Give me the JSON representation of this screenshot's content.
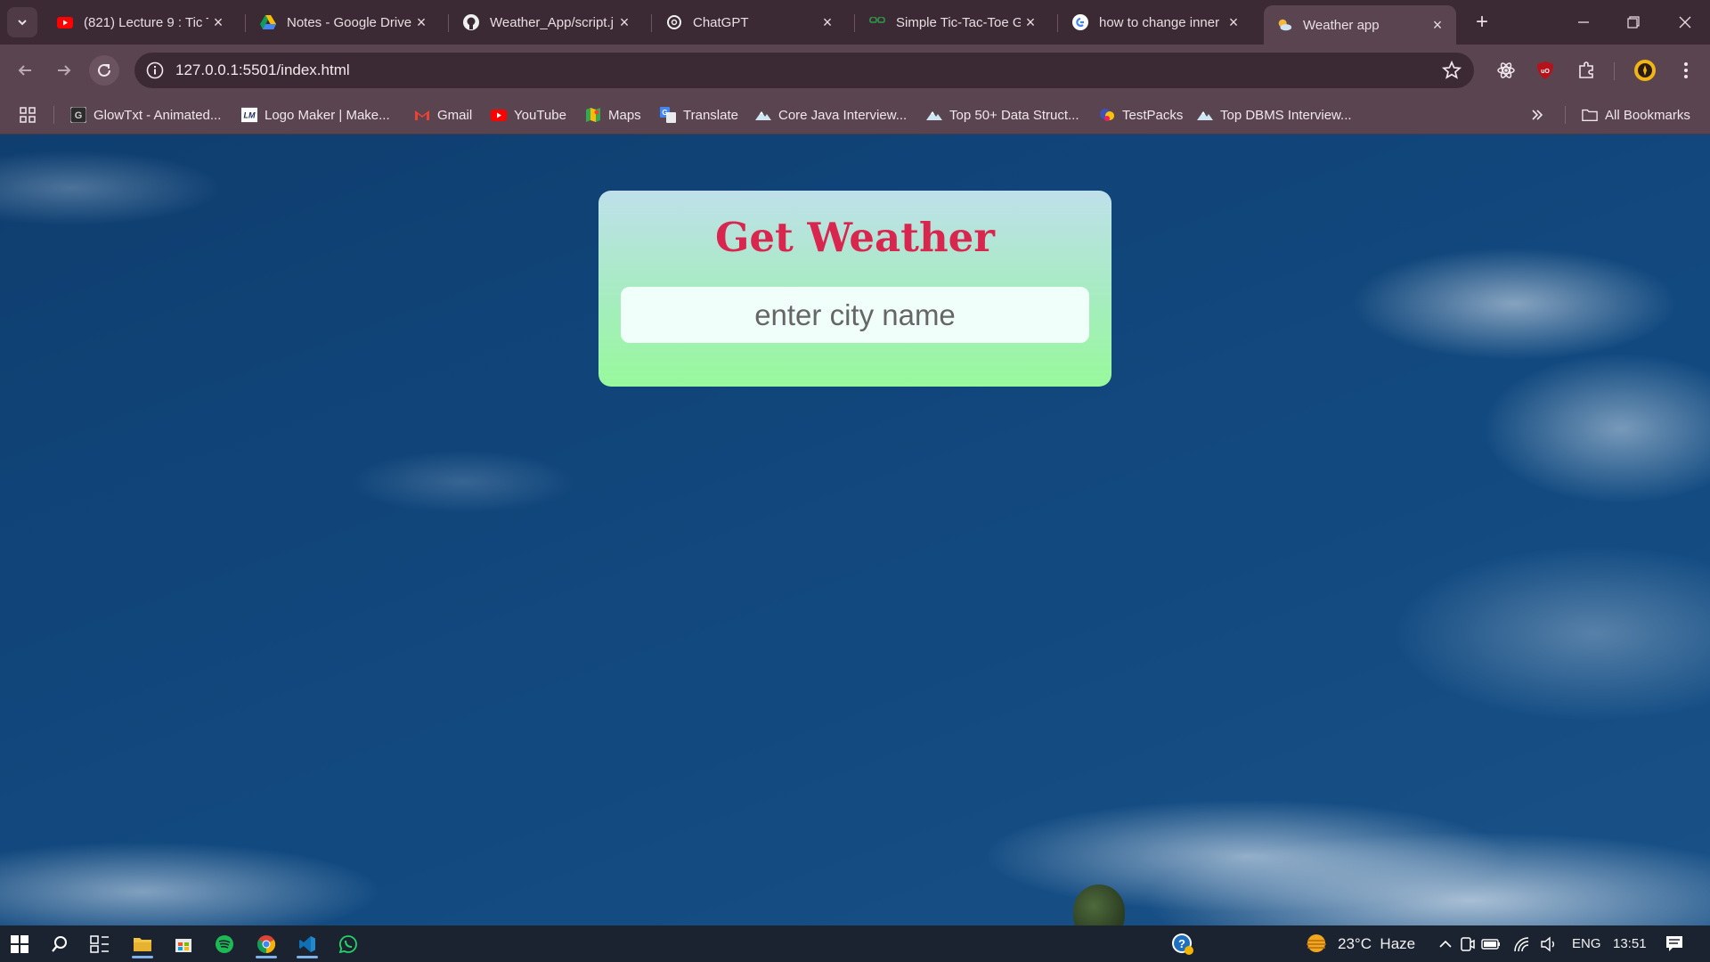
{
  "browser": {
    "tabs": [
      {
        "title": "(821) Lecture 9 : Tic T",
        "icon": "youtube-icon"
      },
      {
        "title": "Notes - Google Drive",
        "icon": "google-drive-icon"
      },
      {
        "title": "Weather_App/script.j",
        "icon": "github-icon"
      },
      {
        "title": "ChatGPT",
        "icon": "chatgpt-icon"
      },
      {
        "title": "Simple Tic-Tac-Toe G",
        "icon": "geeksforgeeks-icon"
      },
      {
        "title": "how to change inner",
        "icon": "google-icon"
      },
      {
        "title": "Weather app",
        "icon": "weather-app-icon",
        "active": true
      }
    ],
    "url": "127.0.0.1:5501/index.html",
    "bookmarks": [
      {
        "label": "GlowTxt - Animated...",
        "icon": "glowtxt-icon"
      },
      {
        "label": "Logo Maker | Make...",
        "icon": "logo-maker-icon"
      },
      {
        "label": "Gmail",
        "icon": "gmail-icon"
      },
      {
        "label": "YouTube",
        "icon": "youtube-icon"
      },
      {
        "label": "Maps",
        "icon": "maps-icon"
      },
      {
        "label": "Translate",
        "icon": "translate-icon"
      },
      {
        "label": "Core Java Interview...",
        "icon": "interviewbit-icon"
      },
      {
        "label": "Top 50+ Data Struct...",
        "icon": "interviewbit-icon"
      },
      {
        "label": "TestPacks",
        "icon": "testpacks-icon"
      },
      {
        "label": "Top DBMS Interview...",
        "icon": "interviewbit-icon"
      }
    ],
    "all_bookmarks_label": "All Bookmarks"
  },
  "page": {
    "heading": "Get Weather",
    "city_input_placeholder": "enter city name",
    "heading_color": "#d8264f"
  },
  "taskbar": {
    "weather": "23°C  Haze",
    "language": "ENG",
    "time": "13:51"
  }
}
